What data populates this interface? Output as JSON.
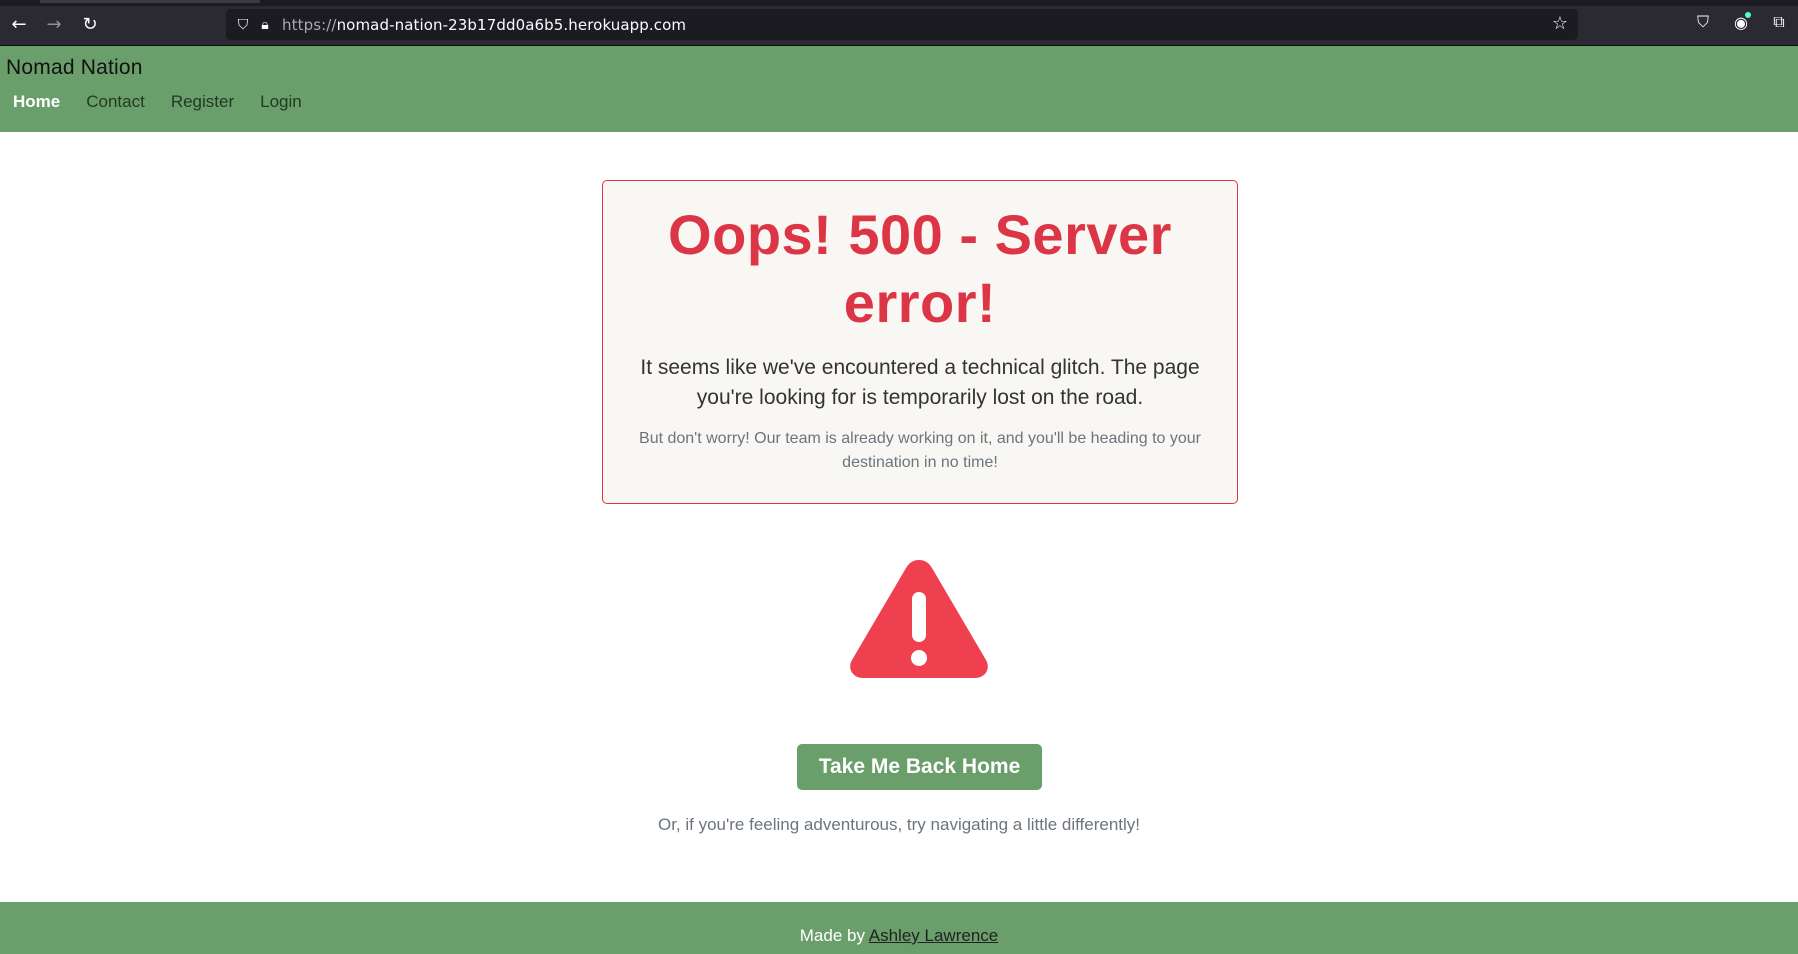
{
  "browser": {
    "url_protocol": "https://",
    "url_host": "nomad-nation-23b17dd0a6b5.herokuapp.com",
    "icons": [
      "back-icon",
      "forward-icon",
      "reload-icon",
      "shield-icon",
      "lock-icon",
      "star-icon",
      "pocket-icon",
      "account-icon",
      "extensions-icon"
    ]
  },
  "header": {
    "brand": "Nomad Nation",
    "nav": [
      {
        "label": "Home",
        "active": true
      },
      {
        "label": "Contact",
        "active": false
      },
      {
        "label": "Register",
        "active": false
      },
      {
        "label": "Login",
        "active": false
      }
    ]
  },
  "error": {
    "title": "Oops! 500 - Server error!",
    "lead": "It seems like we've encountered a technical glitch. The page you're looking for is temporarily lost on the road.",
    "sub": "But don't worry! Our team is already working on it, and you'll be heading to your destination in no time!"
  },
  "actions": {
    "home_button": "Take Me Back Home",
    "adventure_text": "Or, if you're feeling adventurous, try navigating a little differently!"
  },
  "footer": {
    "made_by": "Made by",
    "author": "Ashley Lawrence"
  },
  "colors": {
    "brand_green": "#6a9f6c",
    "error_red": "#dc3545",
    "warning_red": "#ef4050"
  }
}
